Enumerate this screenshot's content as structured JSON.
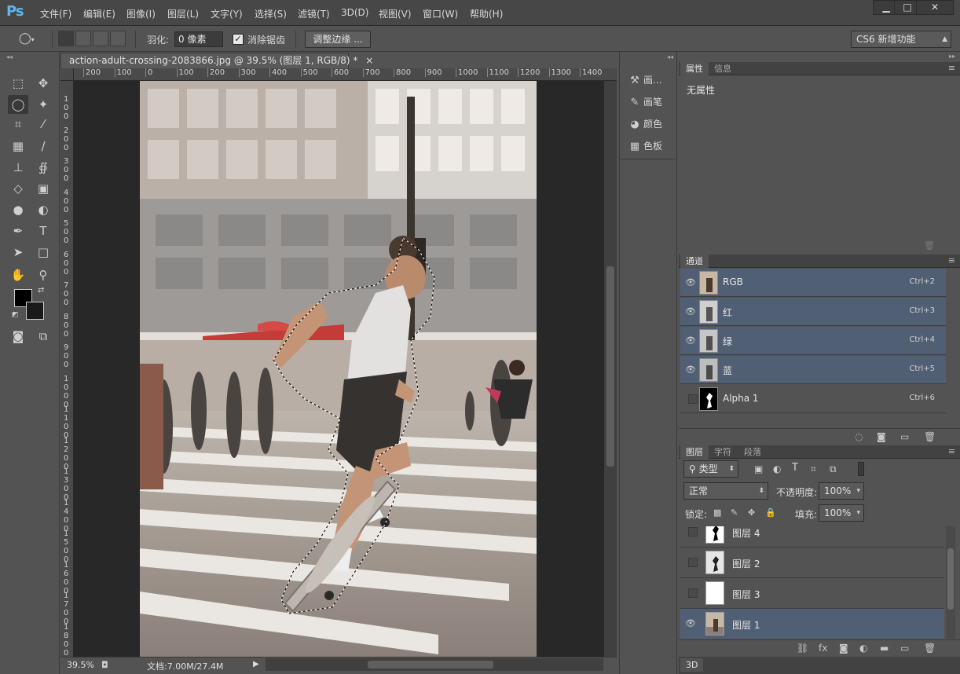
{
  "app": {
    "logo": "Ps"
  },
  "menu": [
    "文件(F)",
    "编辑(E)",
    "图像(I)",
    "图层(L)",
    "文字(Y)",
    "选择(S)",
    "滤镜(T)",
    "3D(D)",
    "视图(V)",
    "窗口(W)",
    "帮助(H)"
  ],
  "window_buttons": {
    "minimize": "▁",
    "maximize": "□",
    "close": "✕"
  },
  "options": {
    "feather_label": "羽化:",
    "feather_value": "0 像素",
    "antialias_label": "消除锯齿",
    "antialias_checked": true,
    "refine_edge_button": "调整边缘 ...",
    "workspace": "CS6 新增功能"
  },
  "document": {
    "tab_title": "action-adult-crossing-2083866.jpg @ 39.5% (图层 1, RGB/8) *",
    "close": "×",
    "ruler_h": [
      "200",
      "100",
      "0",
      "100",
      "200",
      "300",
      "400",
      "500",
      "600",
      "700",
      "800",
      "900",
      "1000",
      "1100",
      "1200",
      "1300",
      "1400"
    ],
    "ruler_v": [
      "1\n0\n0",
      "2\n0\n0",
      "3\n0\n0",
      "4\n0\n0",
      "5\n0\n0",
      "6\n0\n0",
      "7\n0\n0",
      "8\n0\n0",
      "9\n0\n0",
      "1\n0\n0\n0",
      "1\n1\n0\n0",
      "1\n2\n0\n0",
      "1\n3\n0\n0",
      "1\n4\n0\n0",
      "1\n5\n0\n0",
      "1\n6\n0\n0",
      "1\n7\n0\n0",
      "1\n8\n0\n0"
    ],
    "zoom": "39.5%",
    "doc_size": "文档:7.00M/27.4M"
  },
  "icon_panel": {
    "items": [
      {
        "label": "画...",
        "icon": "brush-presets-icon"
      },
      {
        "label": "画笔",
        "icon": "brush-icon"
      },
      {
        "label": "颜色",
        "icon": "color-palette-icon"
      },
      {
        "label": "色板",
        "icon": "swatches-icon"
      }
    ]
  },
  "properties_panel": {
    "tabs": [
      "属性",
      "信息"
    ],
    "content": "无属性"
  },
  "channels_panel": {
    "tab": "通道",
    "channels": [
      {
        "name": "RGB",
        "shortcut": "Ctrl+2",
        "visible": true
      },
      {
        "name": "红",
        "shortcut": "Ctrl+3",
        "visible": true
      },
      {
        "name": "绿",
        "shortcut": "Ctrl+4",
        "visible": true
      },
      {
        "name": "蓝",
        "shortcut": "Ctrl+5",
        "visible": true
      },
      {
        "name": "Alpha 1",
        "shortcut": "Ctrl+6",
        "visible": false
      }
    ]
  },
  "layers_panel": {
    "tabs": [
      "图层",
      "字符",
      "段落"
    ],
    "filter": "类型",
    "blend_mode": "正常",
    "opacity_label": "不透明度:",
    "opacity": "100%",
    "lock_label": "锁定:",
    "fill_label": "填充:",
    "fill": "100%",
    "layers": [
      {
        "name": "图层 4",
        "visible": false
      },
      {
        "name": "图层 2",
        "visible": false
      },
      {
        "name": "图层 3",
        "visible": false
      },
      {
        "name": "图层 1",
        "visible": true
      }
    ]
  },
  "bottom_tab": "3D",
  "colors": {
    "selection": "#515f74",
    "panel": "#535353",
    "canvas_bg": "#282828"
  }
}
